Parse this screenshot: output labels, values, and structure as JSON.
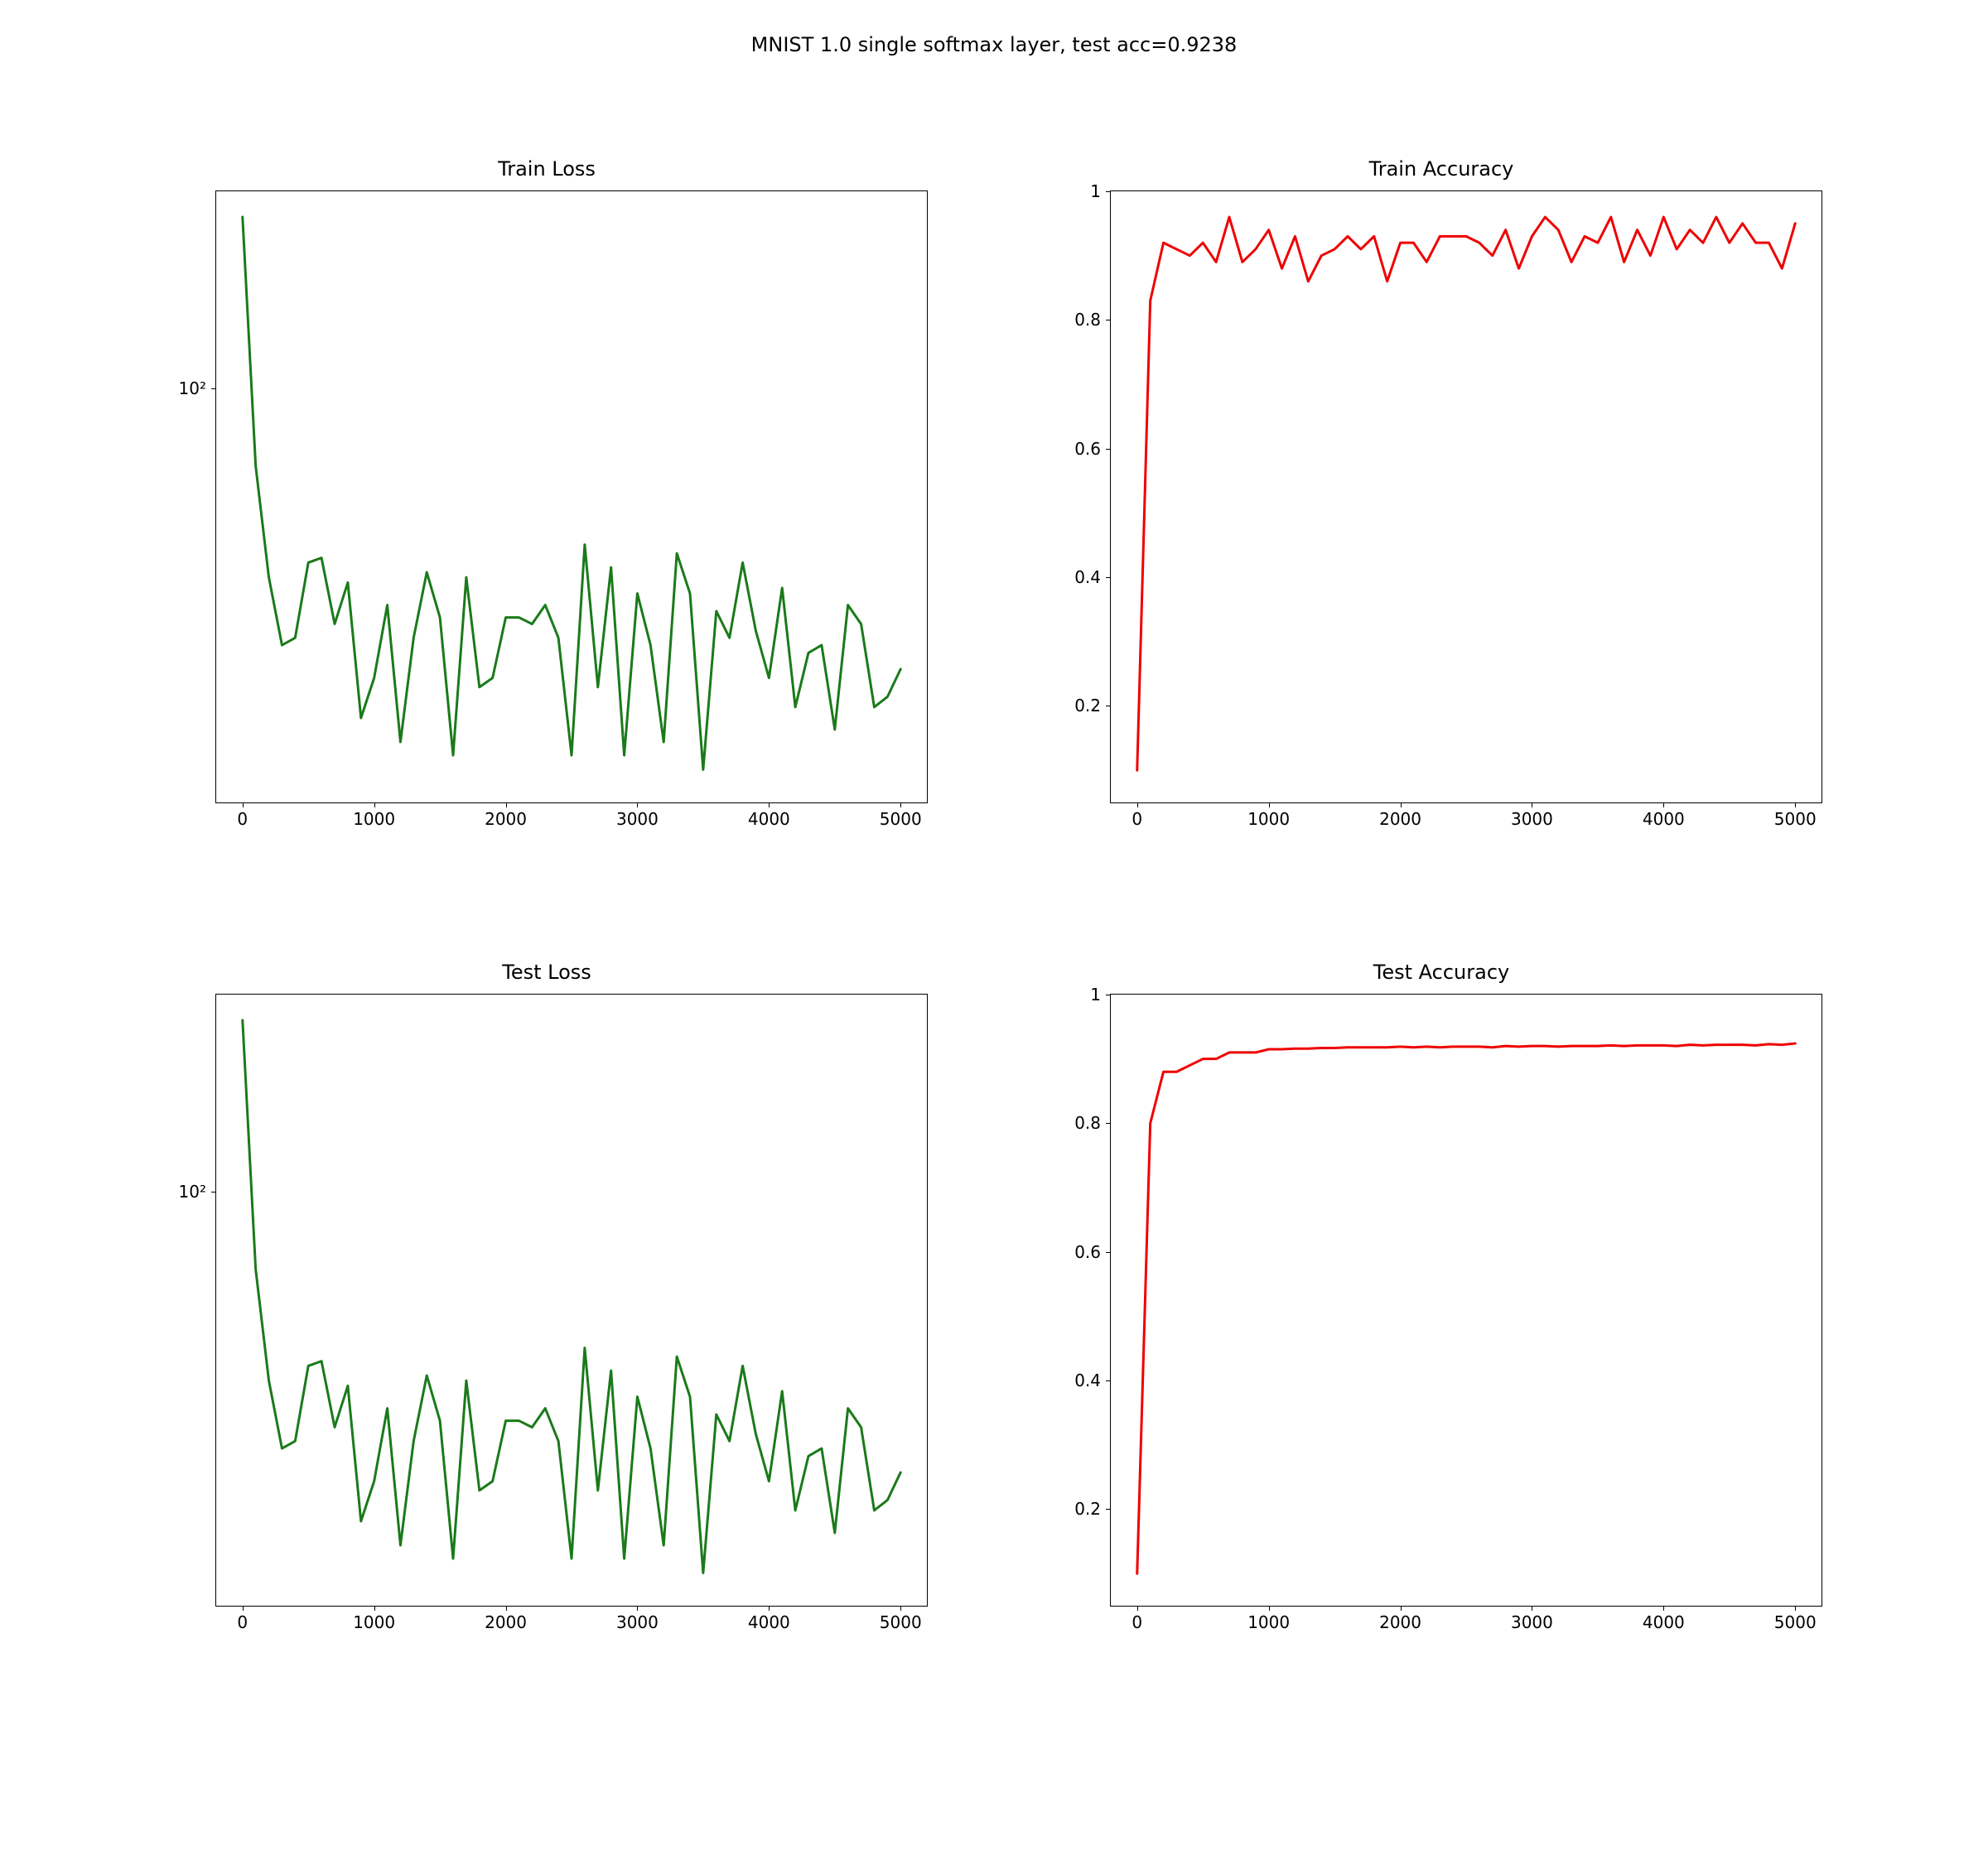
{
  "suptitle": "MNIST 1.0 single softmax layer, test acc=0.9238",
  "panels": {
    "train_loss": {
      "title": "Train Loss"
    },
    "train_acc": {
      "title": "Train Accuracy"
    },
    "test_loss": {
      "title": "Test Loss"
    },
    "test_acc": {
      "title": "Test Accuracy"
    }
  },
  "colors": {
    "loss_line": "#1a7a1a",
    "acc_line": "#ef0000",
    "axis": "#000000"
  },
  "chart_data": [
    {
      "id": "train_loss",
      "type": "line",
      "title": "Train Loss",
      "xlabel": "",
      "ylabel": "",
      "xlim": [
        -200,
        5200
      ],
      "xticks": [
        0,
        1000,
        2000,
        3000,
        4000,
        5000
      ],
      "yscale": "log",
      "ylim": [
        10,
        300
      ],
      "yticks": [
        100
      ],
      "ytick_labels": [
        "10²"
      ],
      "color": "#1a7a1a",
      "x": [
        0,
        100,
        200,
        300,
        400,
        500,
        600,
        700,
        800,
        900,
        1000,
        1100,
        1200,
        1300,
        1400,
        1500,
        1600,
        1700,
        1800,
        1900,
        2000,
        2100,
        2200,
        2300,
        2400,
        2500,
        2600,
        2700,
        2800,
        2900,
        3000,
        3100,
        3200,
        3300,
        3400,
        3500,
        3600,
        3700,
        3800,
        3900,
        4000,
        4100,
        4200,
        4300,
        4400,
        4500,
        4600,
        4700,
        4800,
        4900,
        5000
      ],
      "y": [
        260,
        65,
        35,
        24,
        25,
        38,
        39,
        27,
        34,
        16,
        20,
        30,
        14,
        25,
        36,
        28,
        13,
        35,
        19,
        20,
        28,
        28,
        27,
        30,
        25,
        13,
        42,
        19,
        37,
        13,
        32,
        24,
        14,
        40,
        32,
        12,
        29,
        25,
        38,
        26,
        20,
        33,
        17,
        23,
        24,
        15,
        30,
        27,
        17,
        18,
        21
      ]
    },
    {
      "id": "train_acc",
      "type": "line",
      "title": "Train Accuracy",
      "xlabel": "",
      "ylabel": "",
      "xlim": [
        -200,
        5200
      ],
      "xticks": [
        0,
        1000,
        2000,
        3000,
        4000,
        5000
      ],
      "yscale": "linear",
      "ylim": [
        0.05,
        1.0
      ],
      "yticks": [
        0.2,
        0.4,
        0.6,
        0.8,
        1.0
      ],
      "color": "#ef0000",
      "x": [
        0,
        100,
        200,
        300,
        400,
        500,
        600,
        700,
        800,
        900,
        1000,
        1100,
        1200,
        1300,
        1400,
        1500,
        1600,
        1700,
        1800,
        1900,
        2000,
        2100,
        2200,
        2300,
        2400,
        2500,
        2600,
        2700,
        2800,
        2900,
        3000,
        3100,
        3200,
        3300,
        3400,
        3500,
        3600,
        3700,
        3800,
        3900,
        4000,
        4100,
        4200,
        4300,
        4400,
        4500,
        4600,
        4700,
        4800,
        4900,
        5000
      ],
      "y": [
        0.1,
        0.83,
        0.92,
        0.91,
        0.9,
        0.92,
        0.89,
        0.96,
        0.89,
        0.91,
        0.94,
        0.88,
        0.93,
        0.86,
        0.9,
        0.91,
        0.93,
        0.91,
        0.93,
        0.86,
        0.92,
        0.92,
        0.89,
        0.93,
        0.93,
        0.93,
        0.92,
        0.9,
        0.94,
        0.88,
        0.93,
        0.96,
        0.94,
        0.89,
        0.93,
        0.92,
        0.96,
        0.89,
        0.94,
        0.9,
        0.96,
        0.91,
        0.94,
        0.92,
        0.96,
        0.92,
        0.95,
        0.92,
        0.92,
        0.88,
        0.95
      ]
    },
    {
      "id": "test_loss",
      "type": "line",
      "title": "Test Loss",
      "xlabel": "",
      "ylabel": "",
      "xlim": [
        -200,
        5200
      ],
      "xticks": [
        0,
        1000,
        2000,
        3000,
        4000,
        5000
      ],
      "yscale": "log",
      "ylim": [
        10,
        300
      ],
      "yticks": [
        100
      ],
      "ytick_labels": [
        "10²"
      ],
      "color": "#1a7a1a",
      "x": [
        0,
        100,
        200,
        300,
        400,
        500,
        600,
        700,
        800,
        900,
        1000,
        1100,
        1200,
        1300,
        1400,
        1500,
        1600,
        1700,
        1800,
        1900,
        2000,
        2100,
        2200,
        2300,
        2400,
        2500,
        2600,
        2700,
        2800,
        2900,
        3000,
        3100,
        3200,
        3300,
        3400,
        3500,
        3600,
        3700,
        3800,
        3900,
        4000,
        4100,
        4200,
        4300,
        4400,
        4500,
        4600,
        4700,
        4800,
        4900,
        5000
      ],
      "y": [
        260,
        65,
        35,
        24,
        25,
        38,
        39,
        27,
        34,
        16,
        20,
        30,
        14,
        25,
        36,
        28,
        13,
        35,
        19,
        20,
        28,
        28,
        27,
        30,
        25,
        13,
        42,
        19,
        37,
        13,
        32,
        24,
        14,
        40,
        32,
        12,
        29,
        25,
        38,
        26,
        20,
        33,
        17,
        23,
        24,
        15,
        30,
        27,
        17,
        18,
        21
      ]
    },
    {
      "id": "test_acc",
      "type": "line",
      "title": "Test Accuracy",
      "xlabel": "",
      "ylabel": "",
      "xlim": [
        -200,
        5200
      ],
      "xticks": [
        0,
        1000,
        2000,
        3000,
        4000,
        5000
      ],
      "yscale": "linear",
      "ylim": [
        0.05,
        1.0
      ],
      "yticks": [
        0.2,
        0.4,
        0.6,
        0.8,
        1.0
      ],
      "color": "#ef0000",
      "x": [
        0,
        100,
        200,
        300,
        400,
        500,
        600,
        700,
        800,
        900,
        1000,
        1100,
        1200,
        1300,
        1400,
        1500,
        1600,
        1700,
        1800,
        1900,
        2000,
        2100,
        2200,
        2300,
        2400,
        2500,
        2600,
        2700,
        2800,
        2900,
        3000,
        3100,
        3200,
        3300,
        3400,
        3500,
        3600,
        3700,
        3800,
        3900,
        4000,
        4100,
        4200,
        4300,
        4400,
        4500,
        4600,
        4700,
        4800,
        4900,
        5000
      ],
      "y": [
        0.1,
        0.8,
        0.88,
        0.88,
        0.89,
        0.9,
        0.9,
        0.91,
        0.91,
        0.91,
        0.915,
        0.915,
        0.916,
        0.916,
        0.917,
        0.917,
        0.918,
        0.918,
        0.918,
        0.918,
        0.919,
        0.918,
        0.919,
        0.918,
        0.919,
        0.919,
        0.919,
        0.918,
        0.92,
        0.919,
        0.92,
        0.92,
        0.919,
        0.92,
        0.92,
        0.92,
        0.921,
        0.92,
        0.921,
        0.921,
        0.921,
        0.92,
        0.922,
        0.921,
        0.922,
        0.922,
        0.922,
        0.921,
        0.923,
        0.922,
        0.924
      ]
    }
  ]
}
